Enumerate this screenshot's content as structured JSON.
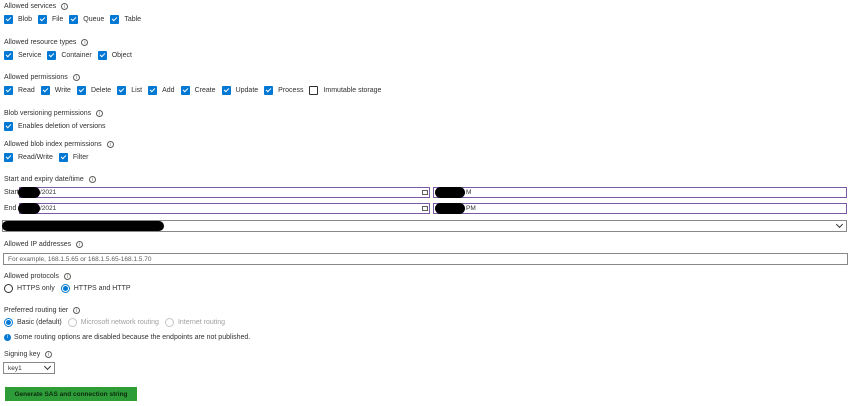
{
  "services": {
    "label": "Allowed services",
    "items": [
      {
        "label": "Blob",
        "checked": true
      },
      {
        "label": "File",
        "checked": true
      },
      {
        "label": "Queue",
        "checked": true
      },
      {
        "label": "Table",
        "checked": true
      }
    ]
  },
  "resource_types": {
    "label": "Allowed resource types",
    "items": [
      {
        "label": "Service",
        "checked": true
      },
      {
        "label": "Container",
        "checked": true
      },
      {
        "label": "Object",
        "checked": true
      }
    ]
  },
  "permissions": {
    "label": "Allowed permissions",
    "items": [
      {
        "label": "Read",
        "checked": true
      },
      {
        "label": "Write",
        "checked": true
      },
      {
        "label": "Delete",
        "checked": true
      },
      {
        "label": "List",
        "checked": true
      },
      {
        "label": "Add",
        "checked": true
      },
      {
        "label": "Create",
        "checked": true
      },
      {
        "label": "Update",
        "checked": true
      },
      {
        "label": "Process",
        "checked": true
      },
      {
        "label": "Immutable storage",
        "checked": false
      }
    ]
  },
  "versioning": {
    "label": "Blob versioning permissions",
    "items": [
      {
        "label": "Enables deletion of versions",
        "checked": true
      }
    ]
  },
  "blob_index": {
    "label": "Allowed blob index permissions",
    "items": [
      {
        "label": "Read/Write",
        "checked": true
      },
      {
        "label": "Filter",
        "checked": true
      }
    ]
  },
  "datetime": {
    "label": "Start and expiry date/time",
    "start_label": "Start",
    "end_label": "End",
    "start_date_suffix": "/2021",
    "end_date_suffix": "/2021",
    "start_time_suffix": "M",
    "end_time_suffix": "PM"
  },
  "ip": {
    "label": "Allowed IP addresses",
    "placeholder": "For example, 168.1.5.65 or 168.1.5.65-168.1.5.70"
  },
  "protocols": {
    "label": "Allowed protocols",
    "options": [
      {
        "label": "HTTPS only",
        "selected": false
      },
      {
        "label": "HTTPS and HTTP",
        "selected": true
      }
    ]
  },
  "routing": {
    "label": "Preferred routing tier",
    "options": [
      {
        "label": "Basic (default)",
        "selected": true,
        "disabled": false
      },
      {
        "label": "Microsoft network routing",
        "selected": false,
        "disabled": true
      },
      {
        "label": "Internet routing",
        "selected": false,
        "disabled": true
      }
    ],
    "note": "Some routing options are disabled because the endpoints are not published."
  },
  "signing": {
    "label": "Signing key",
    "value": "key1"
  },
  "generate_button": "Generate SAS and connection string",
  "icons": {
    "info": "info-icon",
    "calendar": "calendar-icon",
    "chevron": "chevron-down-icon",
    "note": "info-filled-icon"
  },
  "colors": {
    "accent": "#0078d4",
    "highlight": "#2e9e2e",
    "input_border_focus": "#7a5aa6"
  }
}
